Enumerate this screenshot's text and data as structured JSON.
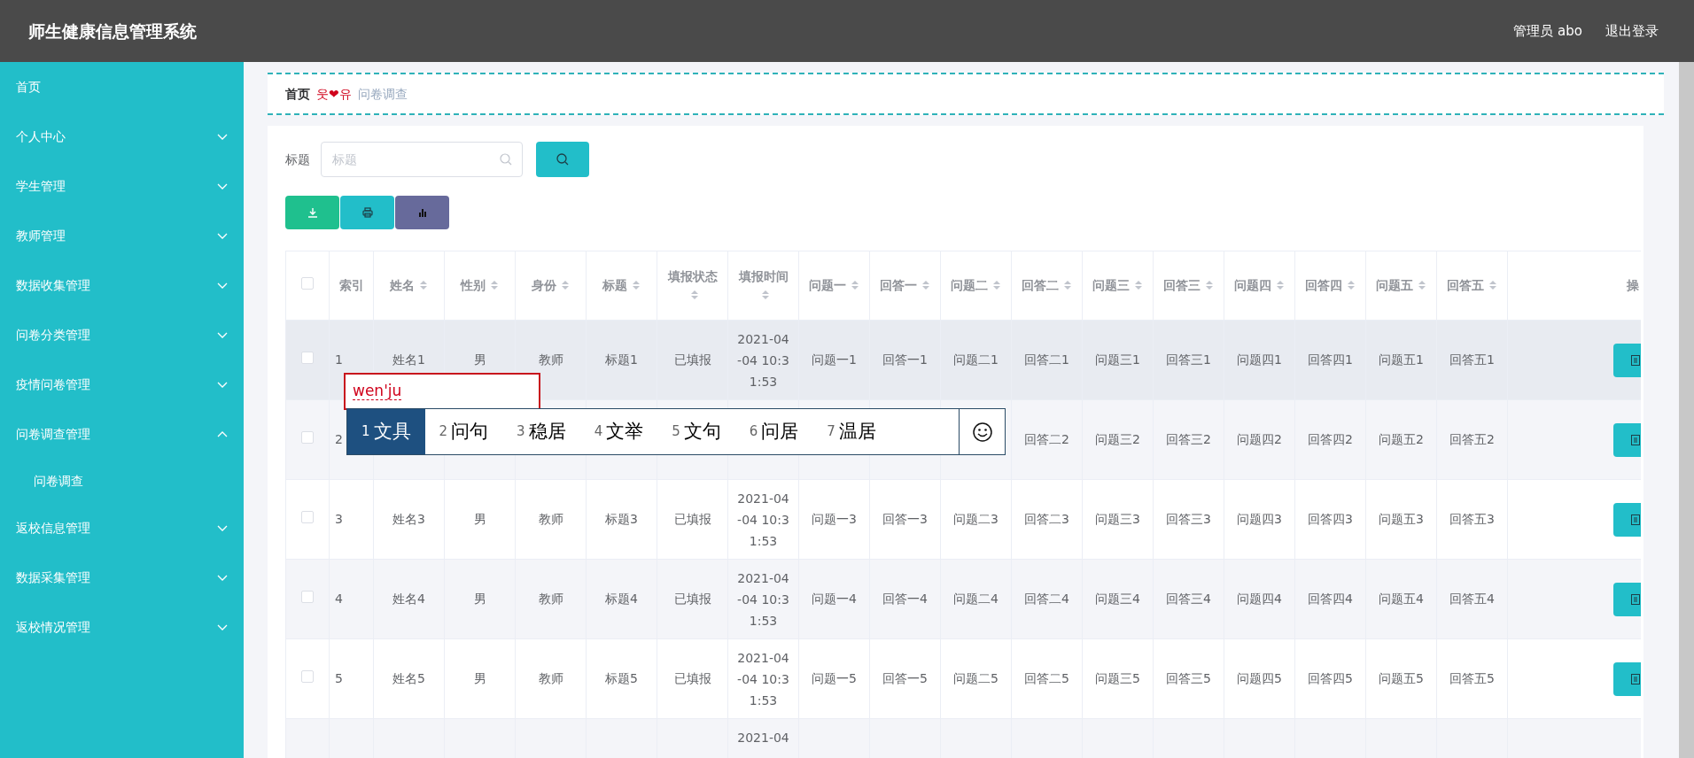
{
  "header": {
    "title": "师生健康信息管理系统",
    "user": "管理员 abo",
    "logout": "退出登录"
  },
  "sidebar": {
    "items": [
      {
        "label": "首页"
      },
      {
        "label": "个人中心",
        "expanded": false
      },
      {
        "label": "学生管理",
        "expanded": false
      },
      {
        "label": "教师管理",
        "expanded": false
      },
      {
        "label": "数据收集管理",
        "expanded": false
      },
      {
        "label": "问卷分类管理",
        "expanded": false
      },
      {
        "label": "疫情问卷管理",
        "expanded": false
      },
      {
        "label": "问卷调查管理",
        "expanded": true,
        "children": [
          {
            "label": "问卷调查"
          }
        ]
      },
      {
        "label": "返校信息管理",
        "expanded": false
      },
      {
        "label": "数据采集管理",
        "expanded": false
      },
      {
        "label": "返校情况管理",
        "expanded": false
      }
    ]
  },
  "breadcrumb": {
    "home": "首页",
    "separator": "웃❤유",
    "current": "问卷调查"
  },
  "search": {
    "label": "标题",
    "placeholder": "标题"
  },
  "table": {
    "select_all_checked": false,
    "columns": [
      {
        "label": "索引",
        "sortable": false
      },
      {
        "label": "姓名",
        "sortable": true
      },
      {
        "label": "性别",
        "sortable": true
      },
      {
        "label": "身份",
        "sortable": true
      },
      {
        "label": "标题",
        "sortable": true
      },
      {
        "label": "填报状态",
        "sortable": true
      },
      {
        "label": "填报时间",
        "sortable": true
      },
      {
        "label": "问题一",
        "sortable": true
      },
      {
        "label": "回答一",
        "sortable": true
      },
      {
        "label": "问题二",
        "sortable": true
      },
      {
        "label": "回答二",
        "sortable": true
      },
      {
        "label": "问题三",
        "sortable": true
      },
      {
        "label": "回答三",
        "sortable": true
      },
      {
        "label": "问题四",
        "sortable": true
      },
      {
        "label": "回答四",
        "sortable": true
      },
      {
        "label": "问题五",
        "sortable": true
      },
      {
        "label": "回答五",
        "sortable": true
      },
      {
        "label": "操",
        "sortable": false
      }
    ],
    "rows": [
      {
        "hovered": true,
        "checked": false,
        "cells": [
          "1",
          "姓名1",
          "男",
          "教师",
          "标题1",
          "已填报",
          "2021-04-04 10:31:53",
          "问题一1",
          "回答一1",
          "问题二1",
          "回答二1",
          "问题三1",
          "回答三1",
          "问题四1",
          "回答四1",
          "问题五1",
          "回答五1"
        ]
      },
      {
        "hovered": false,
        "checked": false,
        "cells": [
          "2",
          null,
          null,
          null,
          null,
          null,
          null,
          null,
          null,
          null,
          "回答二2",
          "问题三2",
          "回答三2",
          "问题四2",
          "回答四2",
          "问题五2",
          "回答五2"
        ]
      },
      {
        "hovered": false,
        "checked": false,
        "cells": [
          "3",
          "姓名3",
          "男",
          "教师",
          "标题3",
          "已填报",
          "2021-04-04 10:31:53",
          "问题一3",
          "回答一3",
          "问题二3",
          "回答二3",
          "问题三3",
          "回答三3",
          "问题四3",
          "回答四3",
          "问题五3",
          "回答五3"
        ]
      },
      {
        "hovered": false,
        "checked": false,
        "cells": [
          "4",
          "姓名4",
          "男",
          "教师",
          "标题4",
          "已填报",
          "2021-04-04 10:31:53",
          "问题一4",
          "回答一4",
          "问题二4",
          "回答二4",
          "问题三4",
          "回答三4",
          "问题四4",
          "回答四4",
          "问题五4",
          "回答五4"
        ]
      },
      {
        "hovered": false,
        "checked": false,
        "cells": [
          "5",
          "姓名5",
          "男",
          "教师",
          "标题5",
          "已填报",
          "2021-04-04 10:31:53",
          "问题一5",
          "回答一5",
          "问题二5",
          "回答二5",
          "问题三5",
          "回答三5",
          "问题四5",
          "回答四5",
          "问题五5",
          "回答五5"
        ]
      },
      {
        "hovered": false,
        "cells": [
          null,
          null,
          null,
          null,
          null,
          null,
          "2021-04",
          null,
          null,
          null,
          null,
          null,
          null,
          null,
          null,
          null,
          null
        ]
      }
    ]
  },
  "ime": {
    "composition": "wen'ju",
    "candidates": [
      {
        "number": "1",
        "text": "文具",
        "selected": true
      },
      {
        "number": "2",
        "text": "问句",
        "selected": false
      },
      {
        "number": "3",
        "text": "稳居",
        "selected": false
      },
      {
        "number": "4",
        "text": "文举",
        "selected": false
      },
      {
        "number": "5",
        "text": "文句",
        "selected": false
      },
      {
        "number": "6",
        "text": "问居",
        "selected": false
      },
      {
        "number": "7",
        "text": "温居",
        "selected": false
      }
    ]
  }
}
